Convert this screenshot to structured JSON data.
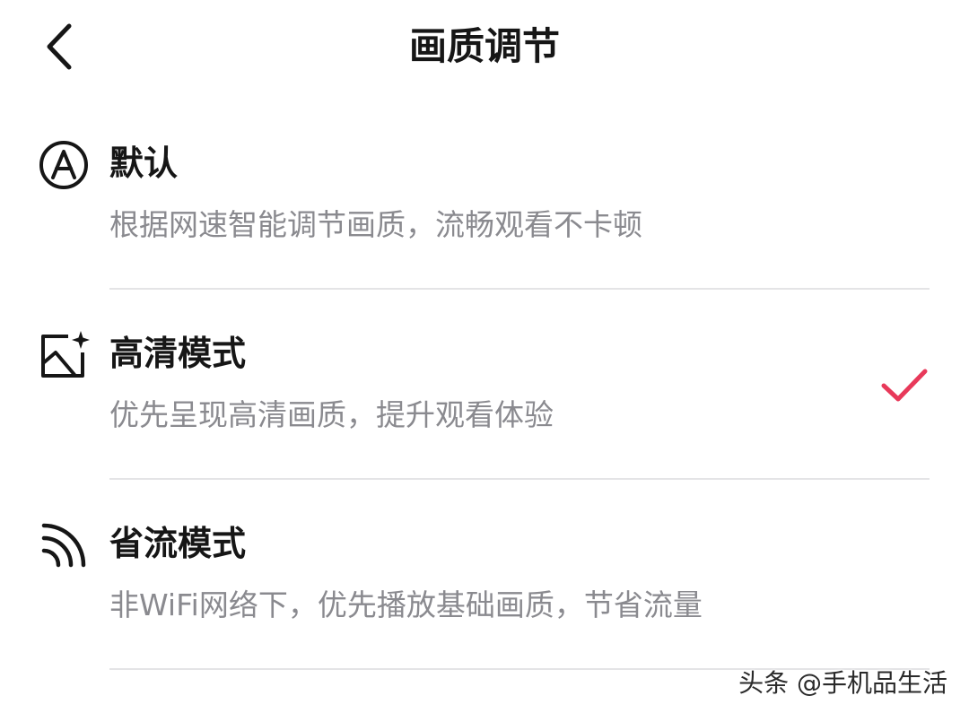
{
  "header": {
    "title": "画质调节",
    "back_icon": "chevron-left-icon"
  },
  "options": [
    {
      "icon": "circle-a-icon",
      "title": "默认",
      "description": "根据网速智能调节画质，流畅观看不卡顿",
      "selected": false
    },
    {
      "icon": "image-sparkle-icon",
      "title": "高清模式",
      "description": "优先呈现高清画质，提升观看体验",
      "selected": true
    },
    {
      "icon": "signal-waves-icon",
      "title": "省流模式",
      "description": "非WiFi网络下，优先播放基础画质，节省流量",
      "selected": false
    }
  ],
  "colors": {
    "accent": "#e8395a",
    "text_primary": "#161616",
    "text_secondary": "#8a8a8f",
    "divider": "#e4e4e6",
    "background": "#ffffff"
  },
  "watermark": "头条 @手机品生活"
}
